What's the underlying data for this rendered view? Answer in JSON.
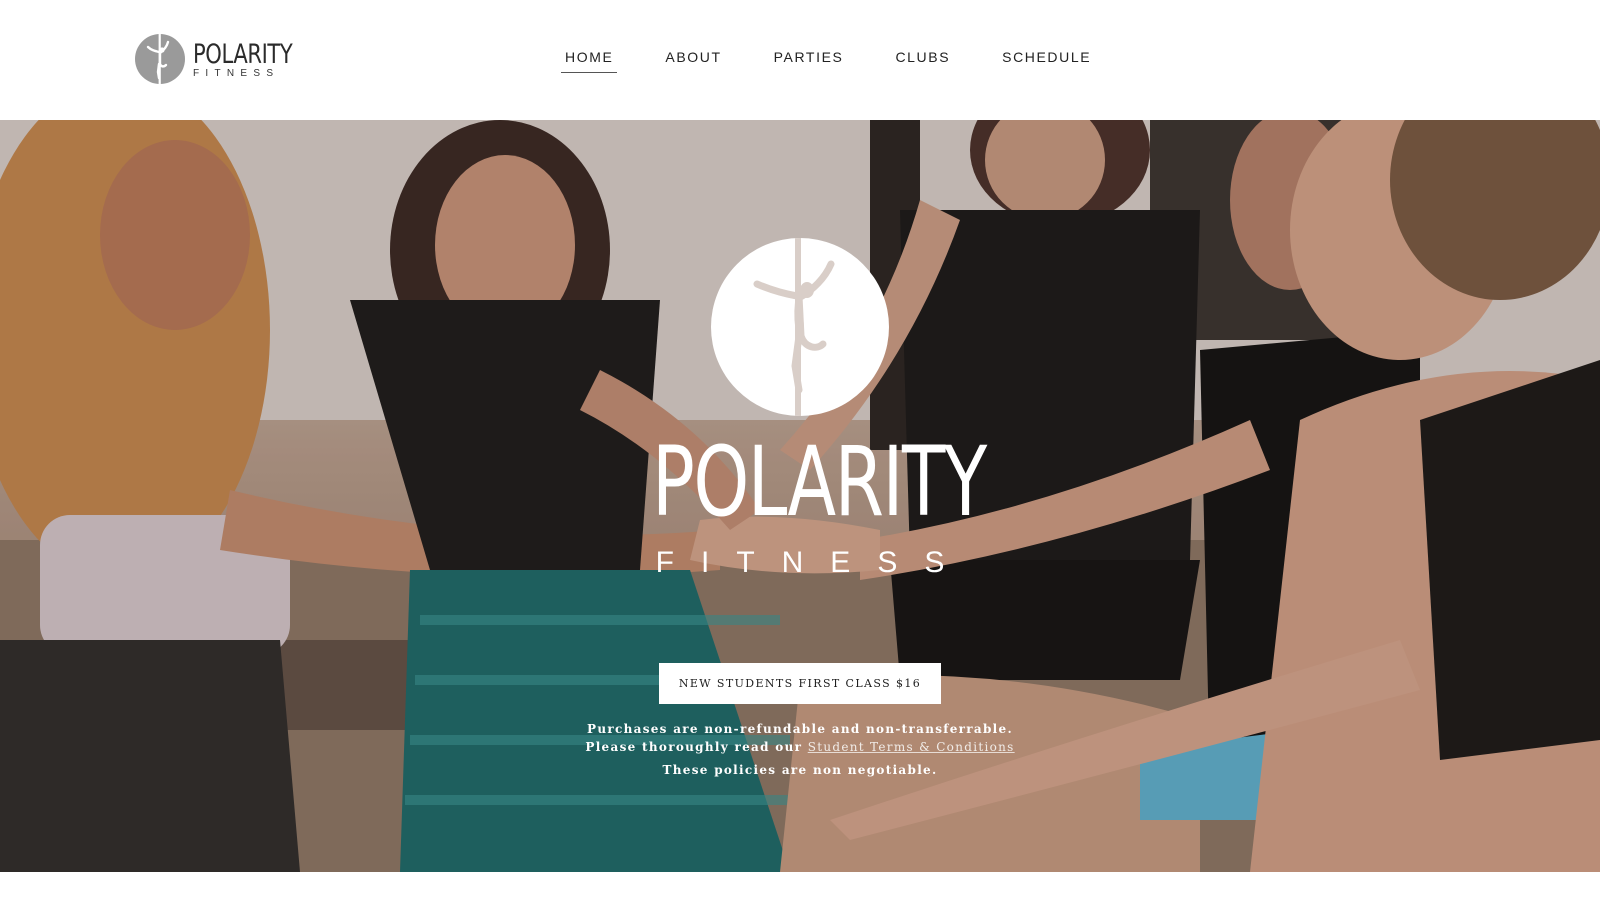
{
  "brand": {
    "name": "POLARITY",
    "tagline": "FITNESS"
  },
  "nav": {
    "items": [
      {
        "label": "HOME",
        "active": true
      },
      {
        "label": "ABOUT",
        "active": false
      },
      {
        "label": "PARTIES",
        "active": false
      },
      {
        "label": "CLUBS",
        "active": false
      },
      {
        "label": "SCHEDULE",
        "active": false
      }
    ]
  },
  "hero": {
    "logo_word": "POLARITY",
    "logo_sub": "FITNESS",
    "cta_label": "NEW STUDENTS FIRST CLASS $16",
    "notice_line1": "Purchases are non-refundable and non-transferrable.",
    "notice_line2_prefix": "Please thoroughly read our",
    "notice_link": "Student Terms & Conditions",
    "notice_line3": "These policies are non negotiable."
  },
  "colors": {
    "logo_badge": "#9a9a9a",
    "hero_text": "#ffffff",
    "cta_background": "#ffffff"
  },
  "icons": {
    "logo": "pole-dancer-silhouette-icon"
  }
}
